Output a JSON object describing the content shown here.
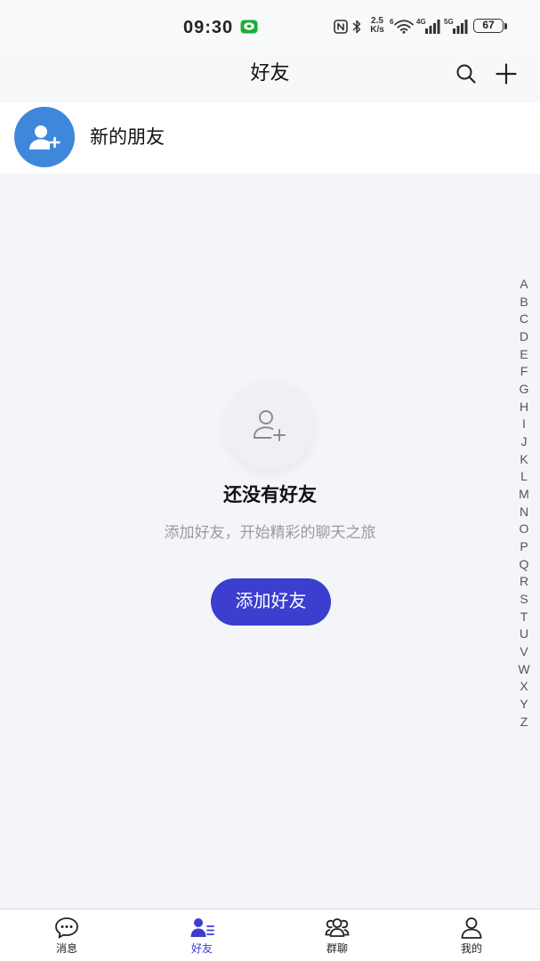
{
  "status_bar": {
    "time": "09:30",
    "speed_value": "2.5",
    "speed_unit": "K/s",
    "wifi_label": "6",
    "network_1": "4G",
    "network_2": "5G",
    "battery": "67"
  },
  "header": {
    "title": "好友",
    "actions": [
      "search-icon",
      "plus-icon"
    ]
  },
  "new_friends": {
    "label": "新的朋友",
    "icon": "add-person-icon"
  },
  "alphabet_index": [
    "A",
    "B",
    "C",
    "D",
    "E",
    "F",
    "G",
    "H",
    "I",
    "J",
    "K",
    "L",
    "M",
    "N",
    "O",
    "P",
    "Q",
    "R",
    "S",
    "T",
    "U",
    "V",
    "W",
    "X",
    "Y",
    "Z"
  ],
  "empty_state": {
    "icon": "add-person-outline-icon",
    "title": "还没有好友",
    "subtitle": "添加好友，开始精彩的聊天之旅",
    "button_label": "添加好友"
  },
  "bottom_nav": {
    "tabs": [
      {
        "label": "消息",
        "icon": "chat-bubble-icon",
        "active": false
      },
      {
        "label": "好友",
        "icon": "contacts-icon",
        "active": true
      },
      {
        "label": "群聊",
        "icon": "group-icon",
        "active": false
      },
      {
        "label": "我的",
        "icon": "profile-icon",
        "active": false
      }
    ]
  },
  "colors": {
    "accent": "#3b3ecf",
    "avatar": "#3f87da",
    "notification_green": "#1aad3a"
  }
}
